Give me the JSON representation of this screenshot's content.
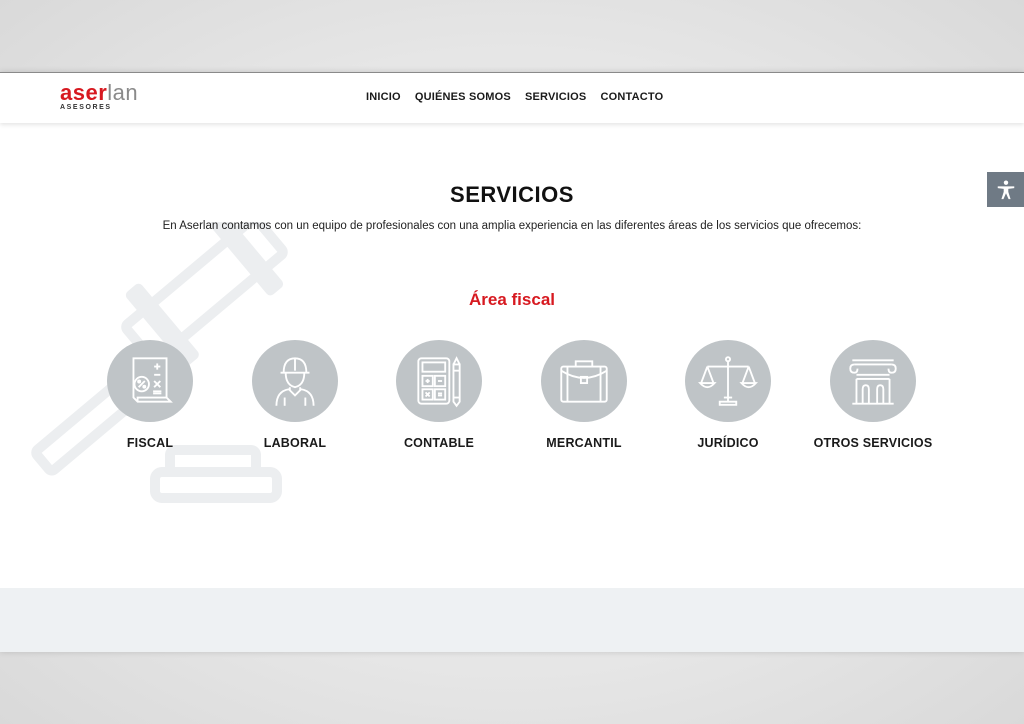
{
  "header": {
    "logo_red": "aser",
    "logo_gray": "lan",
    "logo_sub": "ASESORES",
    "nav": [
      "INICIO",
      "QUIÉNES SOMOS",
      "SERVICIOS",
      "CONTACTO"
    ]
  },
  "main": {
    "title": "SERVICIOS",
    "intro": "En Aserlan contamos con un equipo de profesionales con una amplia experiencia en las diferentes áreas de los servicios que ofrecemos:",
    "area_title": "Área fiscal",
    "services": [
      {
        "label": "FISCAL",
        "icon": "tax-document-icon"
      },
      {
        "label": "LABORAL",
        "icon": "worker-icon"
      },
      {
        "label": "CONTABLE",
        "icon": "calculator-icon"
      },
      {
        "label": "MERCANTIL",
        "icon": "briefcase-icon"
      },
      {
        "label": "JURÍDICO",
        "icon": "scales-icon"
      },
      {
        "label": "OTROS SERVICIOS",
        "icon": "column-icon"
      }
    ]
  },
  "accessibility": {
    "icon": "accessibility-icon"
  },
  "colors": {
    "brand_red": "#d71920",
    "icon_circle": "#bfc4c7",
    "footer_band": "#eef1f3"
  }
}
